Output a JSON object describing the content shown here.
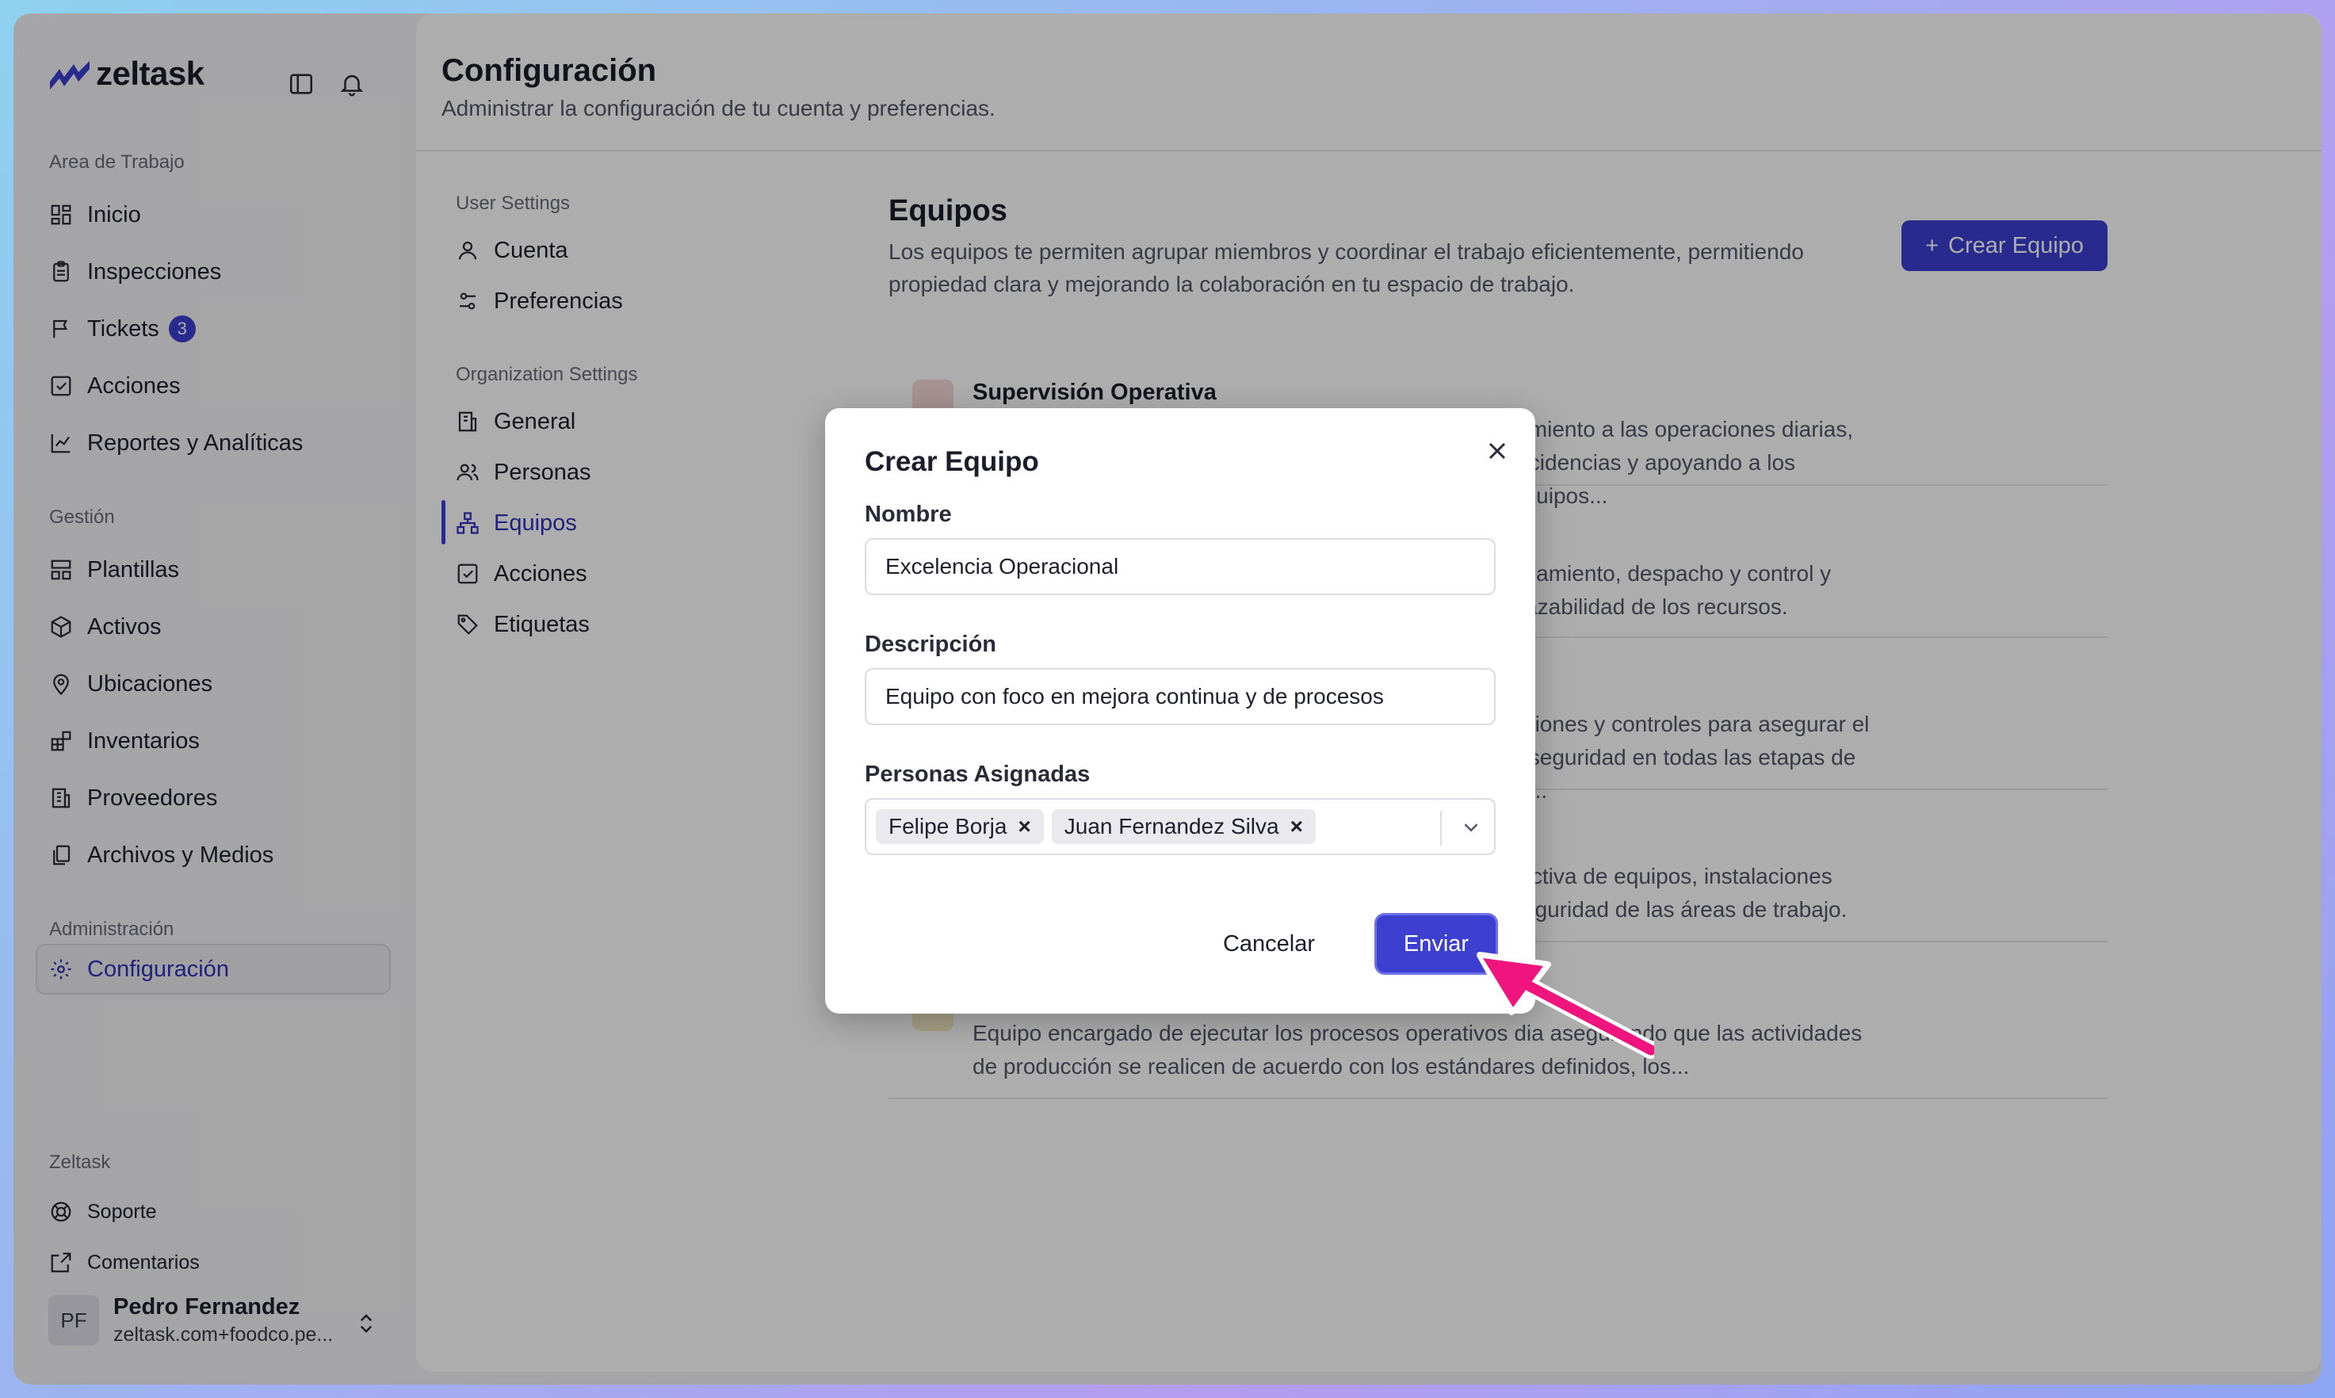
{
  "app": {
    "brand": "zeltask"
  },
  "sidebar": {
    "workspace_label": "Area de Trabajo",
    "workspace_items": [
      {
        "label": "Inicio",
        "icon": "grid-icon"
      },
      {
        "label": "Inspecciones",
        "icon": "clipboard-icon"
      },
      {
        "label": "Tickets",
        "icon": "flag-icon",
        "badge": "3"
      },
      {
        "label": "Acciones",
        "icon": "check-square-icon"
      },
      {
        "label": "Reportes y Analíticas",
        "icon": "chart-line-icon"
      }
    ],
    "management_label": "Gestión",
    "management_items": [
      {
        "label": "Plantillas",
        "icon": "layout-icon"
      },
      {
        "label": "Activos",
        "icon": "box-icon"
      },
      {
        "label": "Ubicaciones",
        "icon": "map-pin-icon"
      },
      {
        "label": "Inventarios",
        "icon": "blocks-icon"
      },
      {
        "label": "Proveedores",
        "icon": "building-icon"
      },
      {
        "label": "Archivos y Medios",
        "icon": "files-icon"
      }
    ],
    "admin_label": "Administración",
    "admin_items": [
      {
        "label": "Configuración",
        "icon": "gear-icon",
        "active": true
      }
    ],
    "footer_label": "Zeltask",
    "footer_items": [
      {
        "label": "Soporte",
        "icon": "lifebuoy-icon"
      },
      {
        "label": "Comentarios",
        "icon": "external-square-icon"
      }
    ],
    "user": {
      "initials": "PF",
      "name": "Pedro Fernandez",
      "email": "zeltask.com+foodco.pe..."
    }
  },
  "main": {
    "title": "Configuración",
    "subtitle": "Administrar la configuración de tu cuenta y preferencias.",
    "user_settings_label": "User Settings",
    "user_settings": [
      "Cuenta",
      "Preferencias"
    ],
    "org_settings_label": "Organization Settings",
    "org_settings": [
      "General",
      "Personas",
      "Equipos",
      "Acciones",
      "Etiquetas"
    ],
    "active_setting": "Equipos"
  },
  "teams": {
    "title": "Equipos",
    "description": "Los equipos te permiten agrupar miembros y coordinar el trabajo eficientemente, permitiendo propiedad clara y mejorando la colaboración en tu espacio de trabajo.",
    "create_label": "Crear Equipo",
    "rows": [
      {
        "name": "Supervisión Operativa",
        "desc": "uimiento a las operaciones diarias, incidencias y apoyando a los equipos..."
      },
      {
        "name": "",
        "desc": "enamiento, despacho y control y trazabilidad de los recursos."
      },
      {
        "name": "",
        "desc": "aciones y controles para asegurar el y seguridad en todas las etapas de la..."
      },
      {
        "name": "",
        "desc": "rectiva de equipos, instalaciones seguridad de las áreas de trabajo."
      },
      {
        "name": "",
        "desc": "Equipo encargado de ejecutar los procesos operativos dia asegurando que las actividades de producción se realicen de acuerdo con los estándares definidos, los..."
      }
    ]
  },
  "modal": {
    "title": "Crear Equipo",
    "name_label": "Nombre",
    "name_value": "Excelencia Operacional",
    "desc_label": "Descripción",
    "desc_value": "Equipo con foco en mejora continua y de procesos",
    "people_label": "Personas Asignadas",
    "people": [
      "Felipe Borja",
      "Juan Fernandez Silva"
    ],
    "chip_remove": "×",
    "cancel_label": "Cancelar",
    "submit_label": "Enviar"
  },
  "colors": {
    "accent": "#3d3fd1",
    "annotation_arrow": "#f0147e"
  }
}
